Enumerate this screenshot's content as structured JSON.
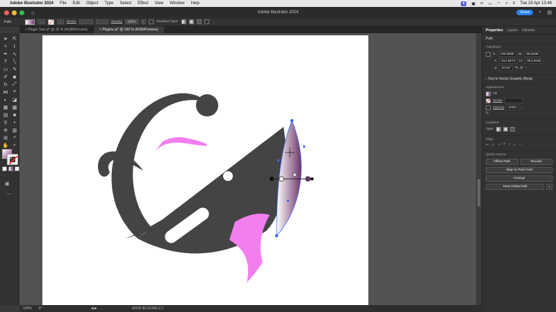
{
  "menubar": {
    "app_name": "Adobe Illustrator 2024",
    "items": [
      "File",
      "Edit",
      "Object",
      "Type",
      "Select",
      "Effect",
      "View",
      "Window",
      "Help"
    ],
    "datetime": "Tue 23 Apr  13:48"
  },
  "window": {
    "title": "Adobe Illustrator 2024",
    "share_label": "Share"
  },
  "controlbar": {
    "selection_type": "Path",
    "stroke_label": "Stroke",
    "opacity_label": "Opacity",
    "opacity_value": "100%",
    "gradient_type_label": "Gradient Type:"
  },
  "tabs": [
    {
      "label": "Plugin Test.ai* @ 25 % (RGB/Preview)"
    },
    {
      "label": "Plugins.ai* @ 100 % (RGB/Preview)"
    }
  ],
  "statusbar": {
    "zoom": "100%",
    "rotation": "0°",
    "profile": "sRGB IEC61966-2.1"
  },
  "panel": {
    "tabs": [
      "Properties",
      "Layers",
      "Libraries"
    ],
    "selection": "Path",
    "transform": {
      "title": "Transform",
      "x_label": "X:",
      "x": "765.8985",
      "y_label": "Y:",
      "y": "514.8674",
      "w_label": "W:",
      "w": "98.6286",
      "h_label": "H:",
      "h": "351.8448",
      "angle": "16.54°"
    },
    "text_to_vector": "Text to Vector Graphic (Beta)",
    "appearance": {
      "title": "Appearance",
      "fill_label": "Fill",
      "stroke_label": "Stroke",
      "opacity_label": "Opacity",
      "opacity_value": "100%",
      "fx_label": "fx."
    },
    "gradient": {
      "title": "Gradient",
      "type_label": "Type:"
    },
    "align": {
      "title": "Align"
    },
    "quick_actions": {
      "title": "Quick Actions",
      "offset_path": "Offset Path",
      "recolor": "Recolor",
      "align_pixel": "Align to Pixel Grid",
      "arrange": "Arrange",
      "global_edit": "Start Global Edit"
    }
  },
  "colors": {
    "art_dark": "#444444",
    "art_pink": "#f27ef0",
    "gradient_end": "#6e3567",
    "selection_blue": "#3d6bff"
  }
}
